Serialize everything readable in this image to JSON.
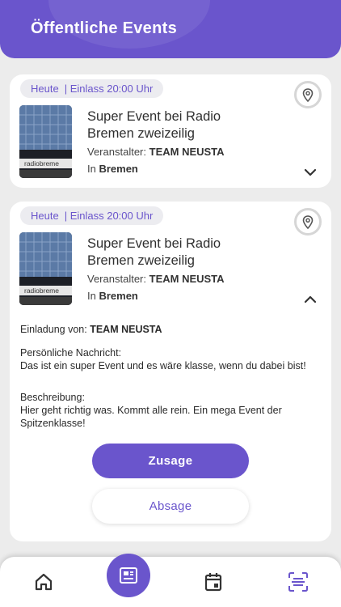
{
  "header": {
    "title": "Öffentliche Events"
  },
  "events": [
    {
      "date_label": "Heute",
      "entry_label": "| Einlass 20:00 Uhr",
      "title": "Super Event bei Radio Bremen zweizeilig",
      "organizer_label": "Veranstalter:",
      "organizer": "TEAM NEUSTA",
      "location_prefix": "In",
      "location": "Bremen",
      "image_sign": "radiobreme",
      "expanded": false
    },
    {
      "date_label": "Heute",
      "entry_label": "| Einlass 20:00 Uhr",
      "title": "Super Event bei Radio Bremen zweizeilig",
      "organizer_label": "Veranstalter:",
      "organizer": "TEAM NEUSTA",
      "location_prefix": "In",
      "location": "Bremen",
      "image_sign": "radiobreme",
      "expanded": true,
      "details": {
        "invited_by_label": "Einladung von:",
        "invited_by": "TEAM NEUSTA",
        "message_label": "Persönliche Nachricht:",
        "message": "Das ist ein super Event und es wäre klasse, wenn du dabei bist!",
        "description_label": "Beschreibung:",
        "description_line1": "Hier geht richtig was. Kommt alle rein. Ein mega Event der",
        "description_line2": "Spitzenklasse!"
      },
      "accept_label": "Zusage",
      "decline_label": "Absage"
    }
  ],
  "nav": {
    "items": [
      "home-icon",
      "events-icon",
      "calendar-icon",
      "scan-icon"
    ],
    "active": "events-icon"
  },
  "colors": {
    "accent": "#6a55cc",
    "background": "#ececec"
  }
}
